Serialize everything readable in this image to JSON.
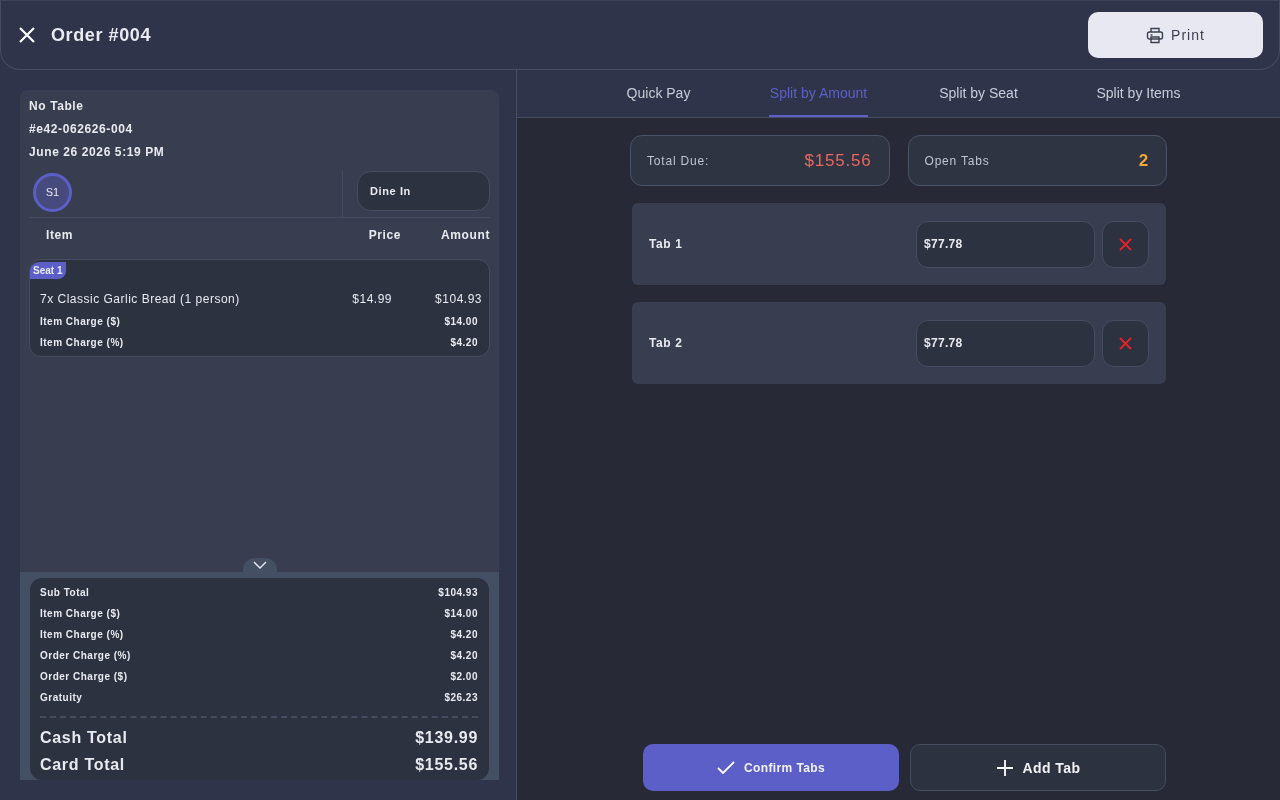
{
  "header": {
    "title": "Order #004",
    "print_button": "Print"
  },
  "order": {
    "table": "No Table",
    "order_number": "#e42-062626-004",
    "datetime": "June 26 2026 5:19 PM",
    "seats": [
      {
        "label": "S1"
      }
    ],
    "order_type": "Dine In",
    "columns": [
      "Item",
      "Price",
      "Amount"
    ],
    "seat_groups": [
      {
        "label": "Seat 1",
        "items": [
          {
            "name": "7x Classic Garlic Bread (1 person)",
            "price": "$14.99",
            "amount": "$104.93",
            "charges": [
              {
                "label": "Item Charge ($)",
                "amount": "$14.00"
              },
              {
                "label": "Item Charge (%)",
                "amount": "$4.20"
              }
            ]
          }
        ]
      }
    ]
  },
  "summary": {
    "lines": [
      {
        "label": "Sub Total",
        "amount": "$104.93"
      },
      {
        "label": "Item Charge ($)",
        "amount": "$14.00"
      },
      {
        "label": "Item Charge (%)",
        "amount": "$4.20"
      },
      {
        "label": "Order Charge (%)",
        "amount": "$4.20"
      },
      {
        "label": "Order Charge ($)",
        "amount": "$2.00"
      },
      {
        "label": "Gratuity",
        "amount": "$26.23"
      }
    ],
    "totals": [
      {
        "label": "Cash Total",
        "amount": "$139.99"
      },
      {
        "label": "Card Total",
        "amount": "$155.56"
      }
    ]
  },
  "payment_tabs": [
    {
      "label": "Quick Pay",
      "selected": false
    },
    {
      "label": "Split by Amount",
      "selected": true
    },
    {
      "label": "Split by Seat",
      "selected": false
    },
    {
      "label": "Split by Items",
      "selected": false
    }
  ],
  "stats": [
    {
      "kind": "amount",
      "label": "Total Due:",
      "value": "$155.56"
    },
    {
      "kind": "count",
      "label": "Open Tabs",
      "value": "2"
    }
  ],
  "split_tabs": [
    {
      "name": "Tab 1",
      "amount": "$77.78"
    },
    {
      "name": "Tab 2",
      "amount": "$77.78"
    }
  ],
  "actions": [
    {
      "kind": "confirm",
      "label": "Confirm Tabs"
    },
    {
      "kind": "add",
      "label": "Add Tab"
    }
  ]
}
